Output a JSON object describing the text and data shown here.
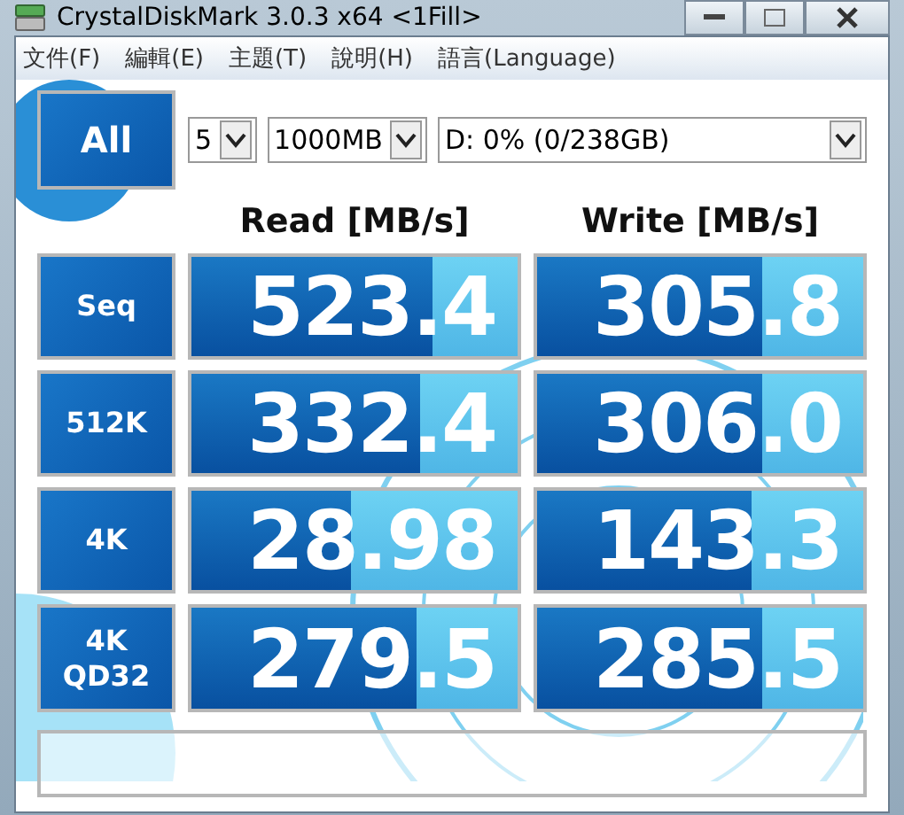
{
  "window": {
    "title": "CrystalDiskMark 3.0.3 x64 <1Fill>"
  },
  "menu": [
    "文件(F)",
    "編輯(E)",
    "主題(T)",
    "說明(H)",
    "語言(Language)"
  ],
  "controls": {
    "all_button": "All",
    "runs": "5",
    "size": "1000MB",
    "drive": "D: 0% (0/238GB)"
  },
  "headers": {
    "read": "Read [MB/s]",
    "write": "Write [MB/s]"
  },
  "tests": [
    {
      "label": "Seq",
      "read": {
        "value": "523.4",
        "level": 0.74
      },
      "write": {
        "value": "305.8",
        "level": 0.69
      }
    },
    {
      "label": "512K",
      "read": {
        "value": "332.4",
        "level": 0.7
      },
      "write": {
        "value": "306.0",
        "level": 0.69
      }
    },
    {
      "label": "4K",
      "read": {
        "value": "28.98",
        "level": 0.49
      },
      "write": {
        "value": "143.3",
        "level": 0.66
      }
    },
    {
      "label": "4K QD32",
      "read": {
        "value": "279.5",
        "level": 0.69
      },
      "write": {
        "value": "285.5",
        "level": 0.69
      }
    }
  ]
}
